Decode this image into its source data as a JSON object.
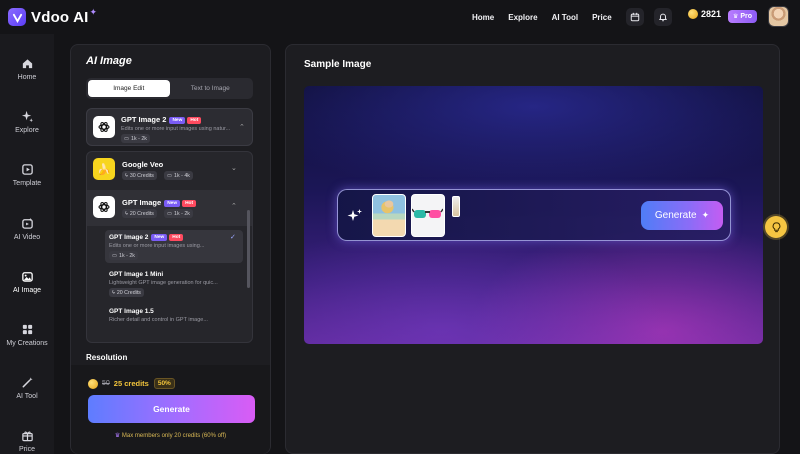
{
  "header": {
    "logo_text": "Vdoo",
    "logo_ai": "AI",
    "nav": [
      "Home",
      "Explore",
      "AI Tool",
      "Price"
    ],
    "credits": "2821",
    "pro_label": "Pro"
  },
  "sidebar": {
    "items": [
      {
        "label": "Home",
        "icon": "home-icon"
      },
      {
        "label": "Explore",
        "icon": "sparkle-icon"
      },
      {
        "label": "Template",
        "icon": "template-icon"
      },
      {
        "label": "AI Video",
        "icon": "video-icon"
      },
      {
        "label": "AI Image",
        "icon": "image-icon"
      },
      {
        "label": "My Creations",
        "icon": "grid-icon"
      },
      {
        "label": "AI Tool",
        "icon": "wand-icon"
      },
      {
        "label": "Price",
        "icon": "gift-icon"
      }
    ]
  },
  "panel": {
    "title": "AI Image",
    "tabs": [
      "Image Edit",
      "Text to Image"
    ],
    "active_tab": 0,
    "selected_model": {
      "name": "GPT Image 2",
      "new": "New",
      "hot": "Hot",
      "desc": "Edits one or more input images using natur...",
      "chip": "1k - 2k"
    },
    "dropdown": {
      "veo": {
        "name": "Google Veo",
        "credits": "30 Credits",
        "res": "1k - 4k"
      },
      "gpt_image": {
        "name": "GPT Image",
        "new": "New",
        "hot": "Hot",
        "credits": "20 Credits",
        "res": "1k - 2k"
      },
      "sub": [
        {
          "name": "GPT Image 2",
          "new": "New",
          "hot": "Hot",
          "desc": "Edits one or more input images using...",
          "chip": "1k - 2k"
        },
        {
          "name": "GPT Image 1 Mini",
          "desc": "Lightweight GPT image generation for quic...",
          "chip": "20 Credits"
        },
        {
          "name": "GPT Image 1.5",
          "desc": "Richer detail and control in GPT image..."
        }
      ]
    },
    "resolution_label": "Resolution",
    "cost_old": "50",
    "cost_new": "25 credits",
    "cost_off": "50%",
    "generate_label": "Generate",
    "member_note": "Max members only 20 credits (60% off)"
  },
  "sample": {
    "title": "Sample Image",
    "generate_label": "Generate"
  }
}
